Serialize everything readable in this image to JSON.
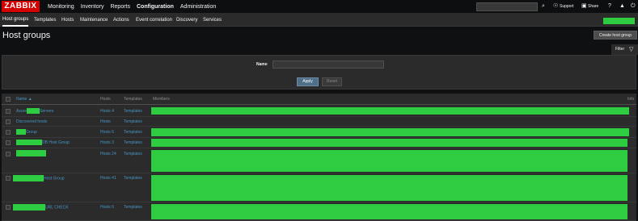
{
  "logo": "ZABBIX",
  "main_menu": [
    {
      "label": "Monitoring",
      "selected": false
    },
    {
      "label": "Inventory",
      "selected": false
    },
    {
      "label": "Reports",
      "selected": false
    },
    {
      "label": "Configuration",
      "selected": true
    },
    {
      "label": "Administration",
      "selected": false
    }
  ],
  "topbar": {
    "support_label": "Support",
    "share_label": "Share",
    "help_label": "?"
  },
  "sub_menu": [
    {
      "label": "Host groups",
      "selected": true
    },
    {
      "label": "Templates",
      "selected": false
    },
    {
      "label": "Hosts",
      "selected": false
    },
    {
      "label": "Maintenance",
      "selected": false
    },
    {
      "label": "Actions",
      "selected": false
    },
    {
      "label": "Event correlation",
      "selected": false
    },
    {
      "label": "Discovery",
      "selected": false
    },
    {
      "label": "Services",
      "selected": false
    }
  ],
  "page": {
    "title": "Host groups",
    "create_button": "Create host group"
  },
  "filter": {
    "tab_label": "Filter",
    "name_label": "Name",
    "name_value": "",
    "apply_label": "Apply",
    "reset_label": "Reset"
  },
  "table": {
    "columns": {
      "name": "Name ▲",
      "hosts": "Hosts",
      "templates": "Templates",
      "members": "Members",
      "info": "Info"
    },
    "rows": [
      {
        "name_prefix": "Azure",
        "name_suffix": "Servers",
        "hosts_label": "Hosts",
        "hosts_count": "4",
        "templates": "Templates"
      },
      {
        "name_prefix": "Discovered hosts",
        "name_suffix": "",
        "hosts_label": "Hosts",
        "hosts_count": "",
        "templates": "Templates"
      },
      {
        "name_prefix": "",
        "name_suffix": "Group",
        "hosts_label": "Hosts",
        "hosts_count": "6",
        "templates": "Templates"
      },
      {
        "name_prefix": "",
        "name_suffix": "DB Host Group",
        "hosts_label": "Hosts",
        "hosts_count": "3",
        "templates": "Templates"
      },
      {
        "name_prefix": "",
        "name_suffix": "",
        "hosts_label": "Hosts",
        "hosts_count": "24",
        "templates": "Templates"
      },
      {
        "name_prefix": "",
        "name_suffix": "Host Group",
        "hosts_label": "Hosts",
        "hosts_count": "41",
        "templates": "Templates"
      },
      {
        "name_prefix": "",
        "name_suffix": "URL CHECK",
        "hosts_label": "Hosts",
        "hosts_count": "6",
        "templates": "Templates"
      }
    ]
  },
  "colors": {
    "accent": "#d40000",
    "link": "#4796c4",
    "redaction": "#2ecc40",
    "background": "#0e1012",
    "panel": "#2b2b2b"
  }
}
